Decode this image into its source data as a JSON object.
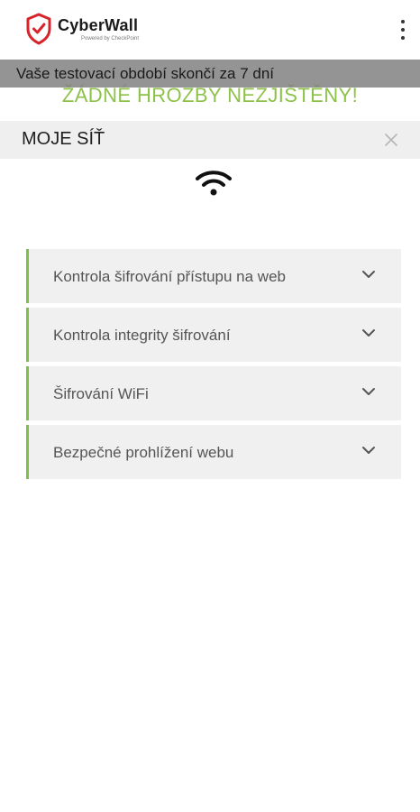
{
  "header": {
    "brand_title": "CyberWall",
    "brand_subtitle": "Powered by CheckPoint",
    "menu_icon": "more-vert-icon"
  },
  "banner": {
    "text": "Vaše testovací období skončí za 7 dní"
  },
  "status": {
    "text": "ŽÁDNÉ HROZBY NEZJIŠTĚNY!",
    "color": "#8dc24a"
  },
  "section": {
    "title": "MOJE SÍŤ",
    "close_icon": "close-icon",
    "network_icon": "wifi-icon"
  },
  "checks": [
    {
      "label": "Kontrola šifrování přístupu na web"
    },
    {
      "label": "Kontrola integrity šifrování"
    },
    {
      "label": "Šifrování WiFi"
    },
    {
      "label": "Bezpečné prohlížení webu"
    }
  ],
  "colors": {
    "accent_green": "#7cc04a",
    "brand_red": "#d6242a",
    "banner_gray": "#7d7d7d"
  }
}
